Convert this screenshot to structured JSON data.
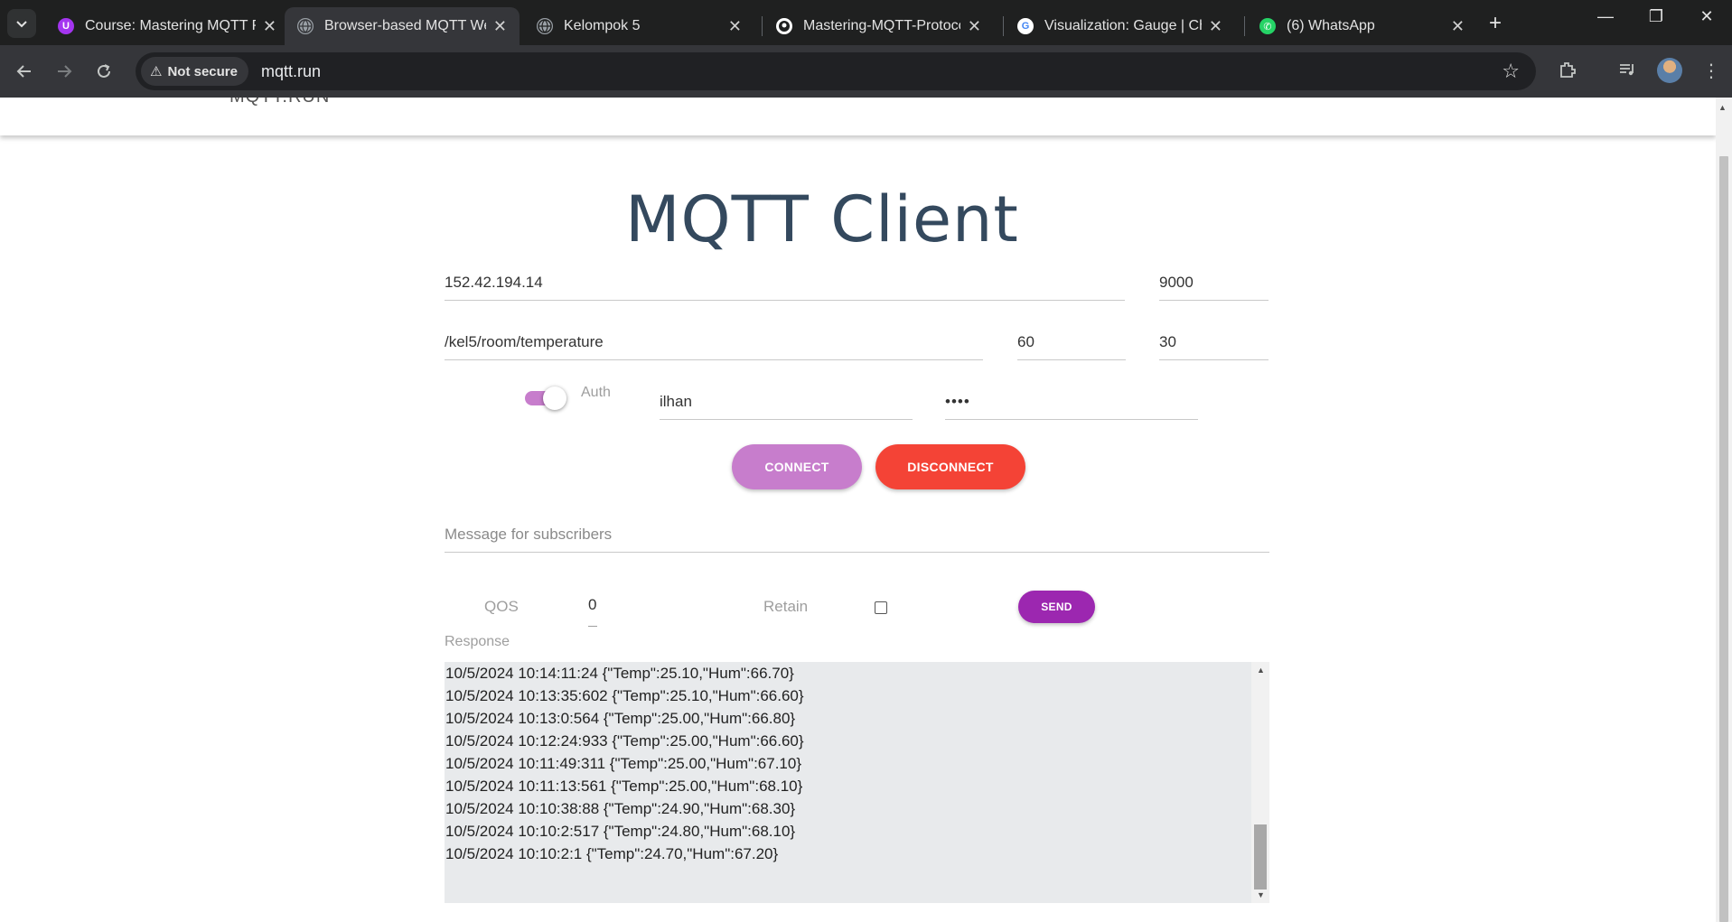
{
  "browser": {
    "tabs": [
      {
        "title": "Course: Mastering MQTT P",
        "favicon": "udemy-icon"
      },
      {
        "title": "Browser-based MQTT Web",
        "favicon": "globe-icon",
        "active": true
      },
      {
        "title": "Kelompok 5",
        "favicon": "globe-icon"
      },
      {
        "title": "Mastering-MQTT-Protocol",
        "favicon": "github-icon"
      },
      {
        "title": "Visualization: Gauge  |  Cha",
        "favicon": "google-icon"
      },
      {
        "title": "(6) WhatsApp",
        "favicon": "whatsapp-icon"
      }
    ],
    "security_label": "Not secure",
    "url": "mqtt.run"
  },
  "site": {
    "logo_text": "MQTT.RUN"
  },
  "client": {
    "heading": "MQTT Client",
    "host": "152.42.194.14",
    "port": "9000",
    "topic": "/kel5/room/temperature",
    "keepalive": "60",
    "timeout": "30",
    "auth_label": "Auth",
    "auth_enabled": true,
    "username": "ilhan",
    "password_mask": "••••",
    "connect_label": "CONNECT",
    "disconnect_label": "DISCONNECT",
    "message_placeholder": "Message for subscribers",
    "qos_label": "QOS",
    "qos_value": "0",
    "retain_label": "Retain",
    "retain_checked": false,
    "send_label": "SEND",
    "response_label": "Response",
    "response_lines": [
      "10/5/2024 10:14:11:24 {\"Temp\":25.10,\"Hum\":66.70}",
      "10/5/2024 10:13:35:602 {\"Temp\":25.10,\"Hum\":66.60}",
      "10/5/2024 10:13:0:564 {\"Temp\":25.00,\"Hum\":66.80}",
      "10/5/2024 10:12:24:933 {\"Temp\":25.00,\"Hum\":66.60}",
      "10/5/2024 10:11:49:311 {\"Temp\":25.00,\"Hum\":67.10}",
      "10/5/2024 10:11:13:561 {\"Temp\":25.00,\"Hum\":68.10}",
      "10/5/2024 10:10:38:88 {\"Temp\":24.90,\"Hum\":68.30}",
      "10/5/2024 10:10:2:517 {\"Temp\":24.80,\"Hum\":68.10}",
      "10/5/2024 10:10:2:1 {\"Temp\":24.70,\"Hum\":67.20}"
    ]
  },
  "colors": {
    "accent_purple": "#c77dcc",
    "send_purple": "#9c27b0",
    "disconnect_red": "#f44336",
    "heading": "#34495e"
  }
}
